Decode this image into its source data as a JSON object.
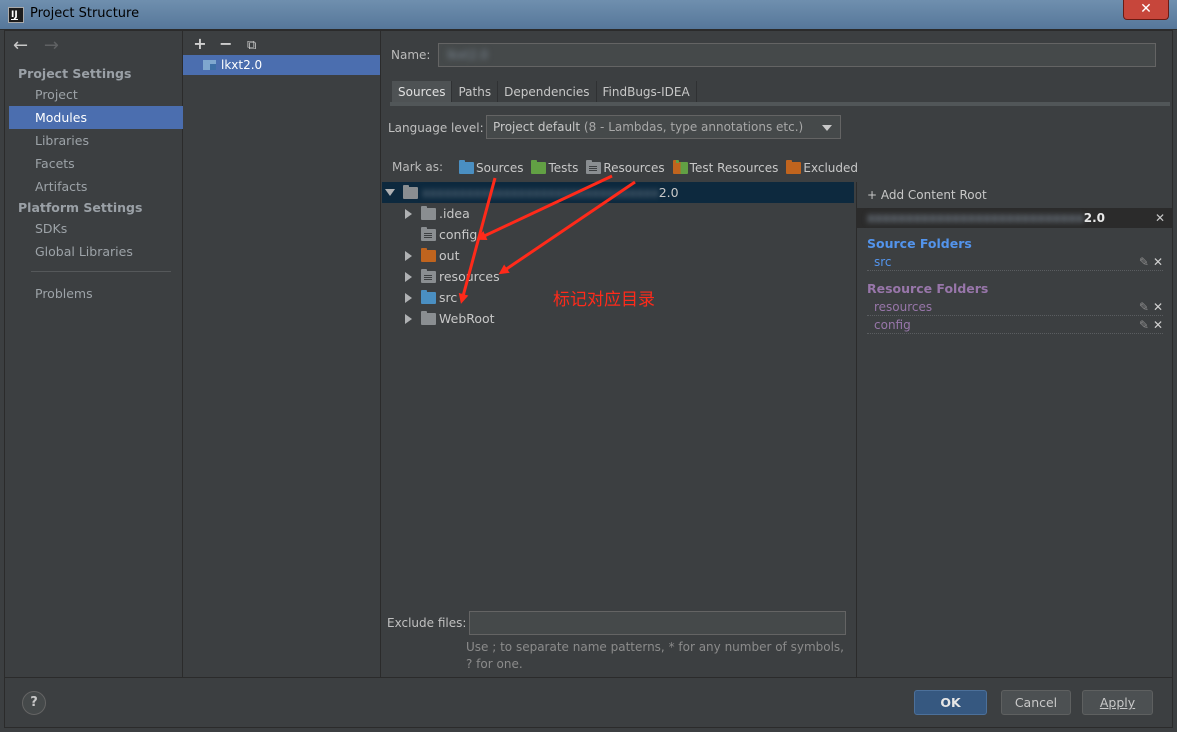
{
  "window": {
    "title": "Project Structure",
    "close_glyph": "✕",
    "app_icon_letters": "IJ"
  },
  "nav": {
    "back_glyph": "←",
    "forward_glyph": "→",
    "project_settings": "Project Settings",
    "platform_settings": "Platform Settings",
    "items": [
      "Project",
      "Modules",
      "Libraries",
      "Facets",
      "Artifacts",
      "SDKs",
      "Global Libraries",
      "Problems"
    ],
    "selected": "Modules"
  },
  "modules": {
    "toolbar": {
      "add": "+",
      "remove": "−",
      "copy": "⧉"
    },
    "items": [
      "lkxt2.0"
    ]
  },
  "module": {
    "name_label": "Name:",
    "name_value": "lkxt2.0",
    "tabs": [
      "Sources",
      "Paths",
      "Dependencies",
      "FindBugs-IDEA"
    ],
    "selected_tab": "Sources",
    "language_level_label": "Language level:",
    "language_level_main": "Project default",
    "language_level_detail": "(8 - Lambdas, type annotations etc.)",
    "mark_as_label": "Mark as:",
    "mark_buttons": [
      "Sources",
      "Tests",
      "Resources",
      "Test Resources",
      "Excluded"
    ],
    "tree": {
      "root_blurred": "xxxxxxxxxxxxxxxxxxxxxxxxxxxxxxxx",
      "root_suffix": "2.0",
      "children": [
        ".idea",
        "config",
        "out",
        "resources",
        "src",
        "WebRoot"
      ]
    },
    "annotation": "标记对应目录",
    "exclude_files_label": "Exclude files:",
    "exclude_files_value": "",
    "exclude_hint": "Use ; to separate name patterns, * for any number of symbols, ? for one."
  },
  "content_root": {
    "add_label": "+ Add Content Root",
    "path_blurred": "xxxxxxxxxxxxxxxxxxxxxxxxxxxx",
    "path_suffix": "2.0",
    "remove_glyph": "✕",
    "source_folders_title": "Source Folders",
    "source_folders": [
      "src"
    ],
    "resource_folders_title": "Resource Folders",
    "resource_folders": [
      "resources",
      "config"
    ],
    "edit_glyph": "✎"
  },
  "footer": {
    "help": "?",
    "ok": "OK",
    "cancel": "Cancel",
    "apply": "Apply"
  },
  "colors": {
    "selection": "#4b6eaf",
    "source_blue": "#5394ec",
    "resource_purple": "#9876aa",
    "annotation_red": "#ff2a1a",
    "ok_button": "#365880"
  }
}
